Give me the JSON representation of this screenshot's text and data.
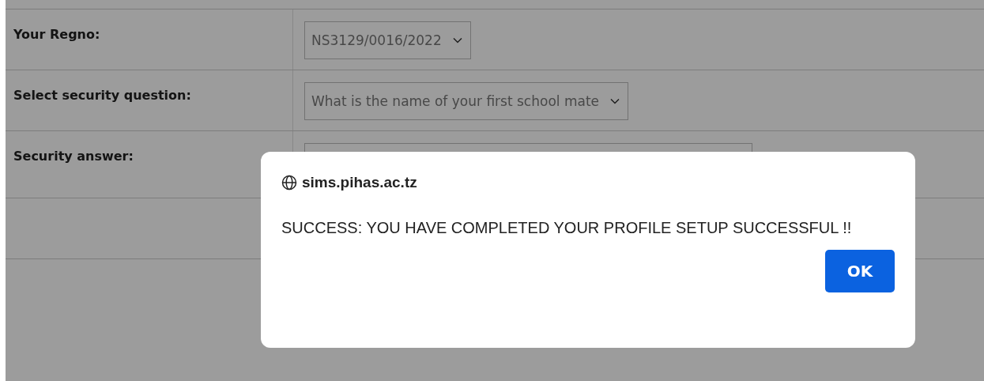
{
  "form": {
    "rows": [
      {
        "label": "Your Regno:",
        "field": {
          "kind": "select",
          "value": "NS3129/0016/2022"
        }
      },
      {
        "label": "Select security question:",
        "field": {
          "kind": "select",
          "value": "What is the name of your first school mate"
        }
      },
      {
        "label": "Security answer:",
        "field": {
          "kind": "input"
        }
      }
    ]
  },
  "dialog": {
    "origin": "sims.pihas.ac.tz",
    "message": "SUCCESS: YOU HAVE COMPLETED YOUR PROFILE SETUP SUCCESSFUL !!",
    "button": "OK"
  }
}
